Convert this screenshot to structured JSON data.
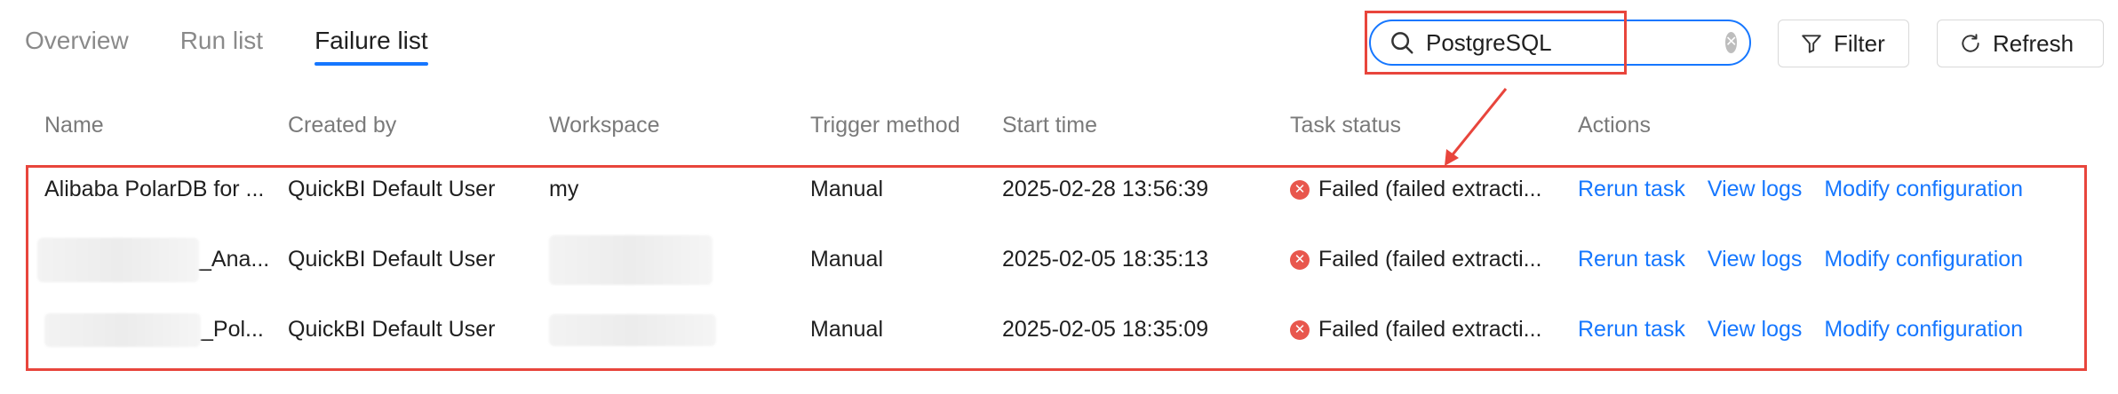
{
  "tabs": [
    {
      "label": "Overview",
      "active": false
    },
    {
      "label": "Run list",
      "active": false
    },
    {
      "label": "Failure list",
      "active": true
    }
  ],
  "search": {
    "value": "PostgreSQL",
    "placeholder": ""
  },
  "toolbar": {
    "filter_label": "Filter",
    "refresh_label": "Refresh"
  },
  "table": {
    "headers": [
      "Name",
      "Created by",
      "Workspace",
      "Trigger method",
      "Start time",
      "Task status",
      "Actions"
    ],
    "rows": [
      {
        "name": "Alibaba PolarDB for ...",
        "created_by": "QuickBI Default User",
        "workspace": "my",
        "trigger": "Manual",
        "start_time": "2025-02-28 13:56:39",
        "status": "Failed (failed extracti...",
        "actions": [
          "Rerun task",
          "View logs",
          "Modify configuration"
        ]
      },
      {
        "name": "_Ana...",
        "created_by": "QuickBI Default User",
        "workspace": "",
        "trigger": "Manual",
        "start_time": "2025-02-05 18:35:13",
        "status": "Failed (failed extracti...",
        "actions": [
          "Rerun task",
          "View logs",
          "Modify configuration"
        ]
      },
      {
        "name": "_Pol...",
        "created_by": "QuickBI Default User",
        "workspace": "",
        "trigger": "Manual",
        "start_time": "2025-02-05 18:35:09",
        "status": "Failed (failed extracti...",
        "actions": [
          "Rerun task",
          "View logs",
          "Modify configuration"
        ]
      }
    ]
  },
  "colors": {
    "accent": "#1677ff",
    "highlight": "#e8453c",
    "error": "#e8574d"
  }
}
